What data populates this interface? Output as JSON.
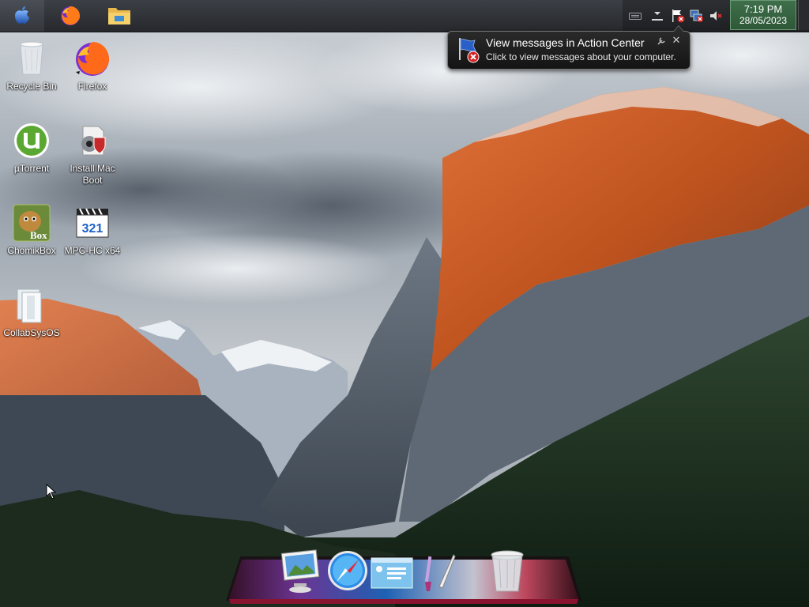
{
  "taskbar": {
    "start_icon": "apple-logo-icon",
    "pinned": [
      {
        "name": "Firefox",
        "icon": "firefox-icon"
      },
      {
        "name": "File Explorer",
        "icon": "folder-icon"
      }
    ],
    "tray_icons": [
      "keyboard-icon",
      "chevron-up-icon",
      "action-center-flag-icon",
      "network-error-icon",
      "speaker-muted-icon"
    ],
    "clock": {
      "time": "7:19 PM",
      "date": "28/05/2023"
    }
  },
  "notification": {
    "title": "View messages in Action Center",
    "text": "Click to view messages about your computer.",
    "icon": "action-center-flag-icon"
  },
  "desktop": {
    "icons": [
      {
        "label": "Recycle Bin",
        "icon": "recycle-bin-icon"
      },
      {
        "label": "Firefox",
        "icon": "firefox-icon"
      },
      {
        "label": "µTorrent",
        "icon": "utorrent-icon"
      },
      {
        "label": "Install Mac Boot",
        "icon": "installer-icon"
      },
      {
        "label": "ChomikBox",
        "icon": "chomikbox-icon"
      },
      {
        "label": "MPC-HC x64",
        "icon": "mpc-hc-icon"
      },
      {
        "label": "CollabSysOS",
        "icon": "book-icon"
      }
    ]
  },
  "dock": {
    "items": [
      {
        "name": "Preview",
        "icon": "photo-monitor-icon"
      },
      {
        "name": "Safari",
        "icon": "compass-icon"
      },
      {
        "name": "Desktop",
        "icon": "desktop-window-icon"
      },
      {
        "name": "Paint",
        "icon": "brush-icon"
      },
      {
        "name": "Trash",
        "icon": "trash-icon"
      }
    ]
  },
  "colors": {
    "taskbar": "#2b2d31",
    "clock_bg": "#3a6a45",
    "balloon_bg": "#1e1e1e",
    "cliff_orange": "#d0602a"
  }
}
